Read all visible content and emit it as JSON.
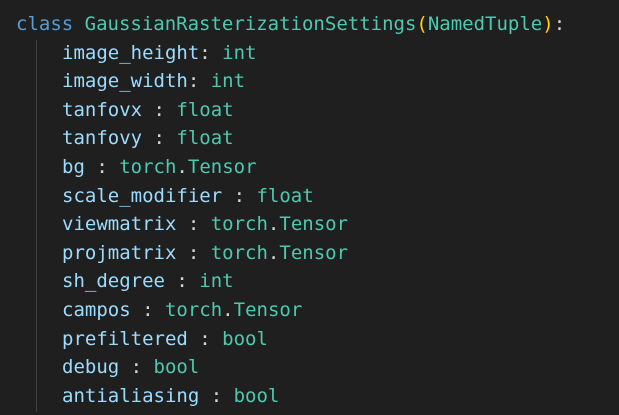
{
  "class_decl": {
    "keyword": "class",
    "name": "GaussianRasterizationSettings",
    "open_paren": "(",
    "base": "NamedTuple",
    "close_paren": ")",
    "colon": ":"
  },
  "fields": [
    {
      "name": "image_height",
      "sep": ": ",
      "module": "",
      "dot": "",
      "type": "int"
    },
    {
      "name": "image_width",
      "sep": ": ",
      "module": "",
      "dot": "",
      "type": "int"
    },
    {
      "name": "tanfovx",
      "sep": " : ",
      "module": "",
      "dot": "",
      "type": "float"
    },
    {
      "name": "tanfovy",
      "sep": " : ",
      "module": "",
      "dot": "",
      "type": "float"
    },
    {
      "name": "bg",
      "sep": " : ",
      "module": "torch",
      "dot": ".",
      "type": "Tensor"
    },
    {
      "name": "scale_modifier",
      "sep": " : ",
      "module": "",
      "dot": "",
      "type": "float"
    },
    {
      "name": "viewmatrix",
      "sep": " : ",
      "module": "torch",
      "dot": ".",
      "type": "Tensor"
    },
    {
      "name": "projmatrix",
      "sep": " : ",
      "module": "torch",
      "dot": ".",
      "type": "Tensor"
    },
    {
      "name": "sh_degree",
      "sep": " : ",
      "module": "",
      "dot": "",
      "type": "int"
    },
    {
      "name": "campos",
      "sep": " : ",
      "module": "torch",
      "dot": ".",
      "type": "Tensor"
    },
    {
      "name": "prefiltered",
      "sep": " : ",
      "module": "",
      "dot": "",
      "type": "bool"
    },
    {
      "name": "debug",
      "sep": " : ",
      "module": "",
      "dot": "",
      "type": "bool"
    },
    {
      "name": "antialiasing",
      "sep": " : ",
      "module": "",
      "dot": "",
      "type": "bool"
    }
  ],
  "colors": {
    "background": "#1f1f1f",
    "keyword": "#569cd6",
    "class_name": "#4ec9b0",
    "bracket": "#ffd700",
    "variable": "#9cdcfe",
    "type": "#4ec9b0"
  }
}
